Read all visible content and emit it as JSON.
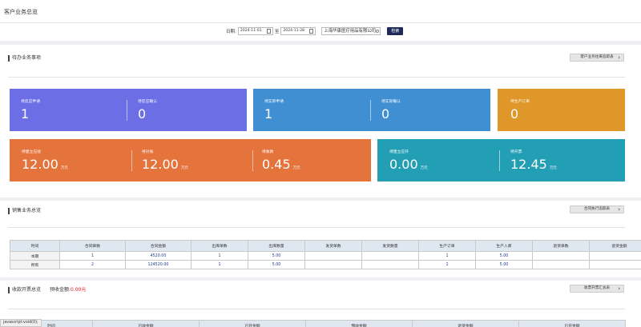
{
  "page_title": "客户业务总览",
  "filter": {
    "date_label": "日期:",
    "start_date": "2024-11-01",
    "separator": "至",
    "end_date": "2024-11-28",
    "company": "上海华康医疗用品有限公司",
    "search_label": "检索"
  },
  "pending": {
    "title": "待办业务事项",
    "button_label": "客户业务往来追踪表",
    "cards": [
      {
        "label": "待反应申请",
        "value": "1",
        "unit": "",
        "color": "#6c6ee6"
      },
      {
        "label": "待反应确认",
        "value": "0",
        "unit": "",
        "color": "#6c6ee6"
      },
      {
        "label": "待实际申请",
        "value": "1",
        "unit": "",
        "color": "#3f8fd2"
      },
      {
        "label": "待实际确认",
        "value": "0",
        "unit": "",
        "color": "#3f8fd2"
      },
      {
        "label": "待生产订单",
        "value": "0",
        "unit": "",
        "color": "#e0972a"
      },
      {
        "label": "待建立应收",
        "value": "12.00",
        "unit": "万元",
        "color": "#e5733c"
      },
      {
        "label": "待对账",
        "value": "12.00",
        "unit": "万元",
        "color": "#e5733c"
      },
      {
        "label": "待收款",
        "value": "0.45",
        "unit": "万元",
        "color": "#e5733c"
      },
      {
        "label": "待建立应开",
        "value": "0.00",
        "unit": "万元",
        "color": "#239fb5"
      },
      {
        "label": "待开票",
        "value": "12.45",
        "unit": "万元",
        "color": "#239fb5"
      }
    ]
  },
  "sales": {
    "title": "销售业务总览",
    "button_label": "合同执行追踪表",
    "headers": [
      "时间",
      "合同单数",
      "合同金额",
      "出库单数",
      "出库数量",
      "发货单数",
      "发货数量",
      "生产订单",
      "生产入库",
      "退货单数",
      "退货金额"
    ],
    "rows": [
      [
        "本期",
        "1",
        "4520.00",
        "1",
        "5.00",
        "",
        "",
        "1",
        "5.00",
        "",
        ""
      ],
      [
        "所有",
        "2",
        "124520.00",
        "1",
        "5.00",
        "",
        "",
        "1",
        "5.00",
        "",
        ""
      ]
    ]
  },
  "invoice": {
    "title": "收款开票总览",
    "prepaid_label": "预收金额:",
    "prepaid_value": "0.00元",
    "button_label": "收票开票汇总表",
    "headers": [
      "时间",
      "已收金额",
      "已开金额",
      "预收金额",
      "退货金额",
      "已开金额"
    ]
  },
  "statusbar": "javascript:void(0);"
}
